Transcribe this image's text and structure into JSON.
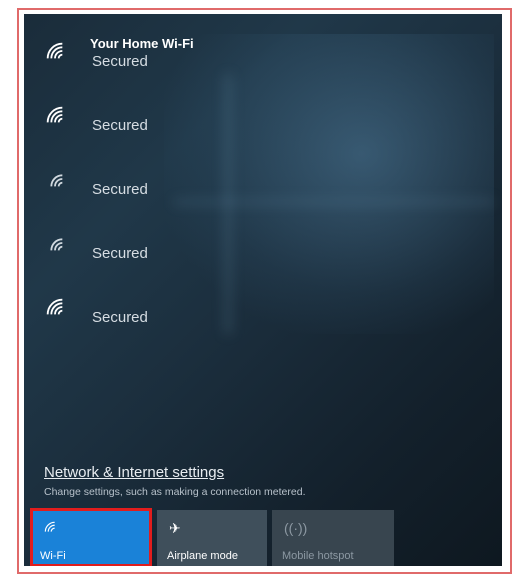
{
  "networks": [
    {
      "name": "Your Home Wi-Fi",
      "status": "Secured"
    },
    {
      "name": "",
      "status": "Secured"
    },
    {
      "name": "",
      "status": "Secured"
    },
    {
      "name": "",
      "status": "Secured"
    },
    {
      "name": "",
      "status": "Secured"
    }
  ],
  "settings": {
    "link": "Network & Internet settings",
    "description": "Change settings, such as making a connection metered."
  },
  "quick_actions": {
    "wifi": {
      "label": "Wi-Fi",
      "icon": "wifi-icon",
      "active": true,
      "color": "#1a82d8"
    },
    "airplane": {
      "label": "Airplane mode",
      "icon": "airplane-icon",
      "active": false
    },
    "hotspot": {
      "label": "Mobile hotspot",
      "icon": "hotspot-icon",
      "active": false
    }
  },
  "highlight_color": "#e11d1d"
}
